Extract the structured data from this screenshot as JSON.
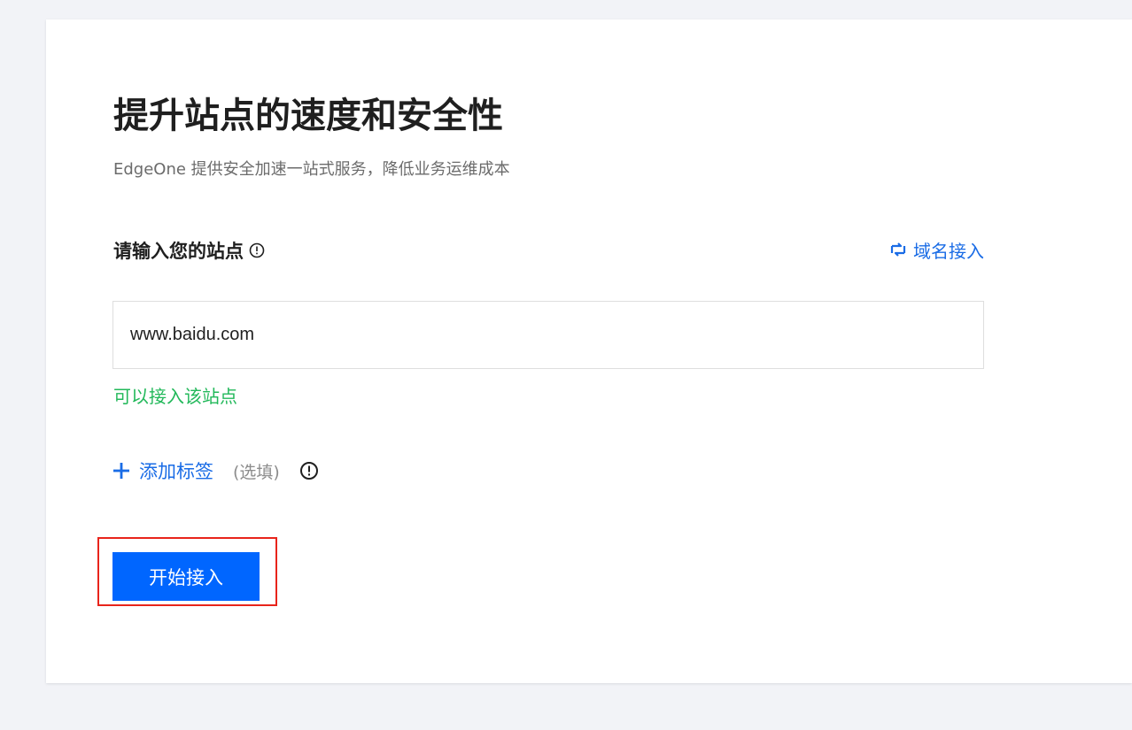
{
  "header": {
    "title": "提升站点的速度和安全性",
    "subtitle": "EdgeOne 提供安全加速一站式服务，降低业务运维成本"
  },
  "site_field": {
    "label": "请输入您的站点",
    "label_info_icon": "info-circle-icon",
    "switch_link_icon": "swap-icon",
    "switch_link_label": "域名接入",
    "value": "www.baidu.com",
    "hint": "可以接入该站点",
    "hint_color": "#22b85a"
  },
  "tags": {
    "add_icon": "plus-icon",
    "add_label": "添加标签",
    "optional_text": "(选填)",
    "info_icon": "info-circle-icon"
  },
  "actions": {
    "start_label": "开始接入",
    "start_color": "#0066ff",
    "highlight_color": "#e8241b"
  },
  "colors": {
    "accent": "#1a6ce6",
    "page_background": "#f2f3f7"
  }
}
